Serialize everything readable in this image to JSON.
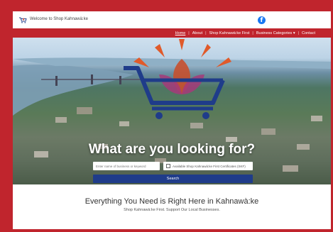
{
  "topbar": {
    "welcome_text": "Welcome to Shop Kahnawà:ke",
    "logo_icon": "cart-flower-icon",
    "social_icon": "facebook-icon"
  },
  "nav": {
    "items": [
      {
        "label": "Home",
        "active": true
      },
      {
        "label": "About"
      },
      {
        "label": "Shop Kahnawà:ke First"
      },
      {
        "label": "Business Categories ▾"
      },
      {
        "label": "Contact"
      }
    ]
  },
  "hero": {
    "title": "What are you looking for?",
    "search_placeholder": "Enter name of business or keyword",
    "filter_label": "Available Shop Kahnawà:ke First Certificates (SKF)",
    "search_button": "Search"
  },
  "intro": {
    "headline": "Everything You Need is Right Here in Kahnawà:ke",
    "subline": "Shop Kahnawà:ke First. Support Our Local Businesses."
  },
  "colors": {
    "brand_red": "#c0252d",
    "cart_blue": "#1f3c8a",
    "button_blue": "#1f3c8a"
  }
}
